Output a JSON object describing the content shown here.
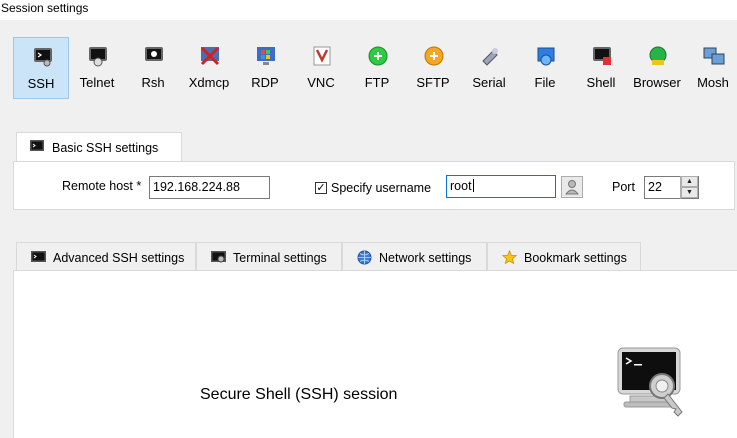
{
  "window": {
    "title": "Session settings"
  },
  "protocols": [
    {
      "label": "SSH",
      "icon": "ssh-icon",
      "selected": true
    },
    {
      "label": "Telnet",
      "icon": "telnet-icon"
    },
    {
      "label": "Rsh",
      "icon": "rsh-icon"
    },
    {
      "label": "Xdmcp",
      "icon": "xdmcp-icon"
    },
    {
      "label": "RDP",
      "icon": "rdp-icon"
    },
    {
      "label": "VNC",
      "icon": "vnc-icon"
    },
    {
      "label": "FTP",
      "icon": "ftp-icon"
    },
    {
      "label": "SFTP",
      "icon": "sftp-icon"
    },
    {
      "label": "Serial",
      "icon": "serial-icon"
    },
    {
      "label": "File",
      "icon": "file-icon"
    },
    {
      "label": "Shell",
      "icon": "shell-icon"
    },
    {
      "label": "Browser",
      "icon": "browser-icon"
    },
    {
      "label": "Mosh",
      "icon": "mosh-icon"
    }
  ],
  "basic": {
    "tab_label": "Basic SSH settings",
    "remote_host_label": "Remote host *",
    "remote_host_value": "192.168.224.88",
    "specify_username_label": "Specify username",
    "specify_username_checked": true,
    "username_value": "root",
    "port_label": "Port",
    "port_value": "22"
  },
  "sub_tabs": [
    {
      "label": "Advanced SSH settings",
      "icon": "terminal-icon"
    },
    {
      "label": "Terminal settings",
      "icon": "terminal-settings-icon"
    },
    {
      "label": "Network settings",
      "icon": "network-icon"
    },
    {
      "label": "Bookmark settings",
      "icon": "star-icon"
    }
  ],
  "panel": {
    "caption": "Secure Shell (SSH) session"
  },
  "colors": {
    "selected_bg": "#cce4f7",
    "selected_border": "#99c9ef",
    "focus_border": "#0078d7"
  }
}
